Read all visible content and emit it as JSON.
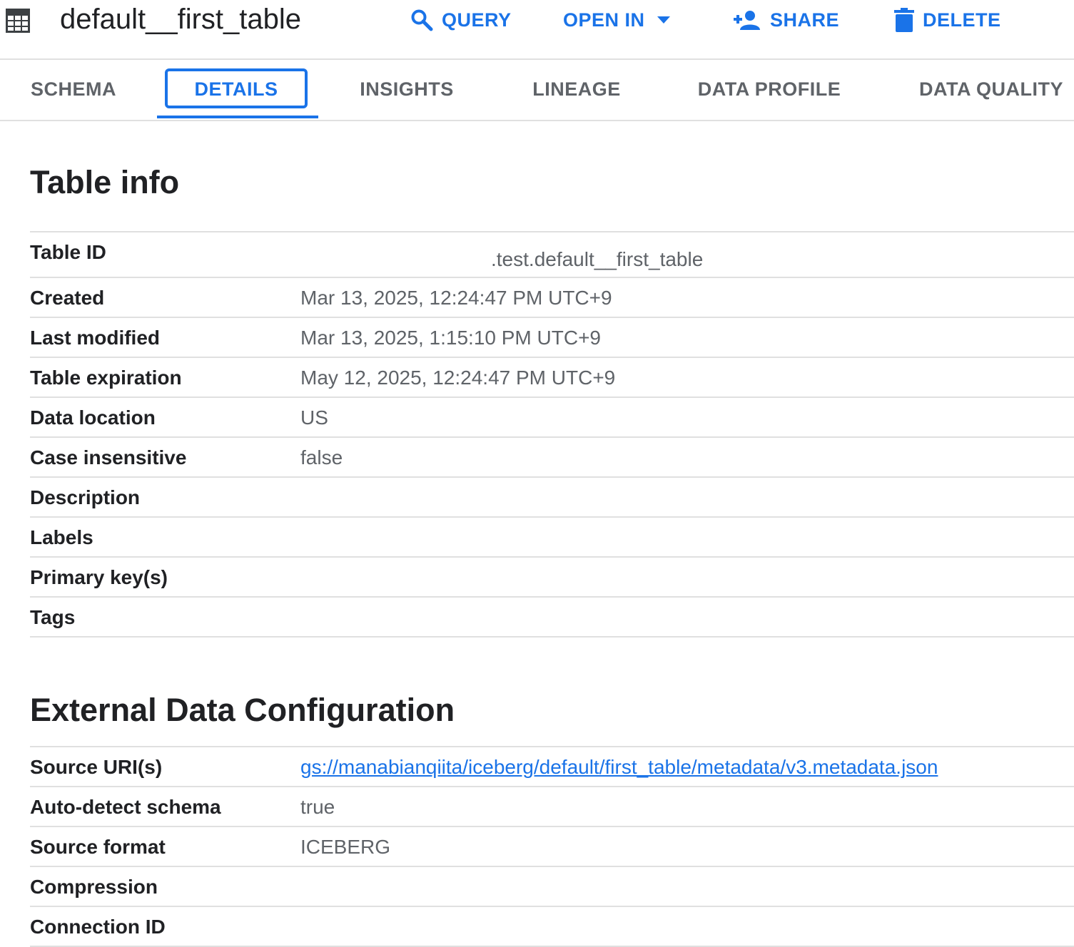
{
  "header": {
    "title": "default__first_table",
    "icon": "table-grid-icon",
    "actions": {
      "query": "QUERY",
      "open_in": "OPEN IN",
      "share": "SHARE",
      "delete": "DELETE"
    },
    "accent_color": "#1a73e8"
  },
  "tabs": {
    "schema": "SCHEMA",
    "details": "DETAILS",
    "insights": "INSIGHTS",
    "lineage": "LINEAGE",
    "data_profile": "DATA PROFILE",
    "data_quality": "DATA QUALITY",
    "active": "DETAILS"
  },
  "table_info": {
    "heading": "Table info",
    "rows": [
      {
        "label": "Table ID",
        "value": ".test.default__first_table"
      },
      {
        "label": "Created",
        "value": "Mar 13, 2025, 12:24:47 PM UTC+9"
      },
      {
        "label": "Last modified",
        "value": "Mar 13, 2025, 1:15:10 PM UTC+9"
      },
      {
        "label": "Table expiration",
        "value": "May 12, 2025, 12:24:47 PM UTC+9"
      },
      {
        "label": "Data location",
        "value": "US"
      },
      {
        "label": "Case insensitive",
        "value": "false"
      },
      {
        "label": "Description",
        "value": ""
      },
      {
        "label": "Labels",
        "value": ""
      },
      {
        "label": "Primary key(s)",
        "value": ""
      },
      {
        "label": "Tags",
        "value": ""
      }
    ]
  },
  "external_config": {
    "heading": "External Data Configuration",
    "rows": [
      {
        "label": "Source URI(s)",
        "value": "gs://manabianqiita/iceberg/default/first_table/metadata/v3.metadata.json"
      },
      {
        "label": "Auto-detect schema",
        "value": "true"
      },
      {
        "label": "Source format",
        "value": "ICEBERG"
      },
      {
        "label": "Compression",
        "value": ""
      },
      {
        "label": "Connection ID",
        "value": ""
      }
    ]
  }
}
